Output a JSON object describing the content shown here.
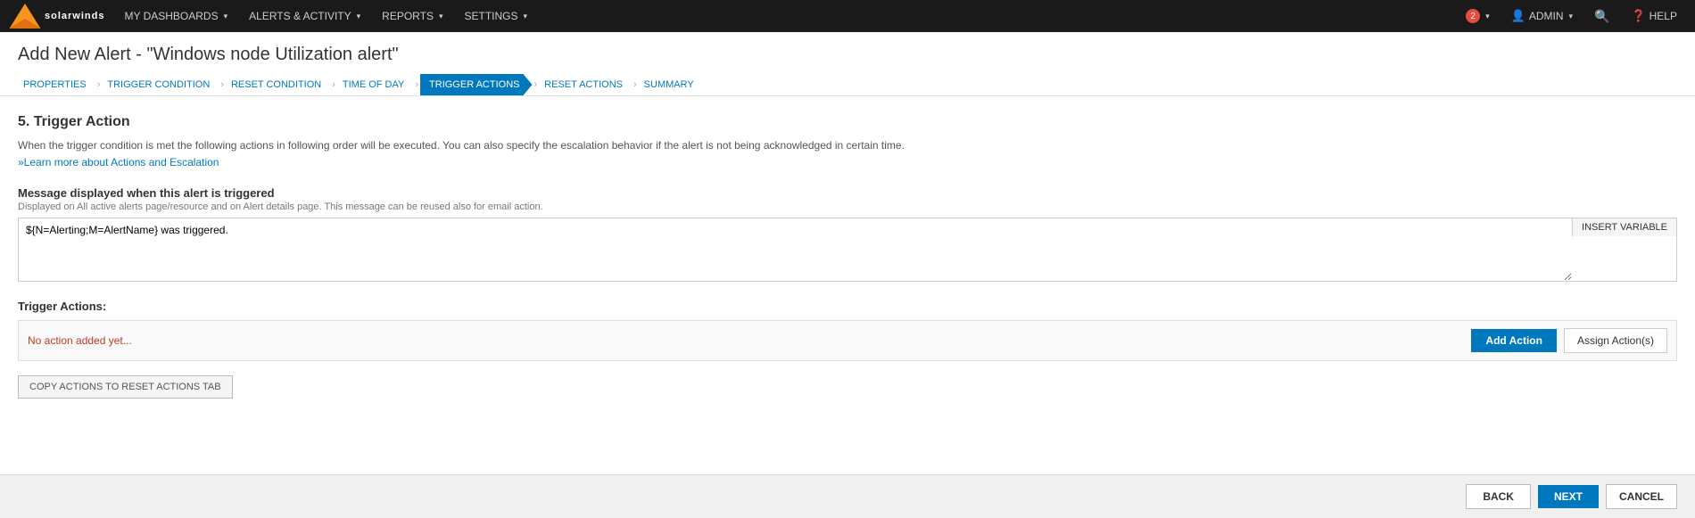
{
  "topnav": {
    "logo_alt": "SolarWinds",
    "menus": [
      {
        "label": "MY DASHBOARDS",
        "has_caret": true
      },
      {
        "label": "ALERTS & ACTIVITY",
        "has_caret": true
      },
      {
        "label": "REPORTS",
        "has_caret": true
      },
      {
        "label": "SETTINGS",
        "has_caret": true
      }
    ],
    "right": [
      {
        "label": "2",
        "type": "notif"
      },
      {
        "label": "ADMIN",
        "has_caret": true
      },
      {
        "label": "🔍",
        "type": "search"
      },
      {
        "label": "HELP",
        "type": "help"
      }
    ]
  },
  "page": {
    "title": "Add New Alert - \"Windows node Utilization alert\"",
    "breadcrumbs": [
      {
        "label": "PROPERTIES",
        "active": false
      },
      {
        "label": "TRIGGER CONDITION",
        "active": false
      },
      {
        "label": "RESET CONDITION",
        "active": false
      },
      {
        "label": "TIME OF DAY",
        "active": false
      },
      {
        "label": "TRIGGER ACTIONS",
        "active": true
      },
      {
        "label": "RESET ACTIONS",
        "active": false
      },
      {
        "label": "SUMMARY",
        "active": false
      }
    ]
  },
  "content": {
    "section_number": "5.",
    "section_title": "Trigger Action",
    "description": "When the trigger condition is met the following actions in following order will be executed. You can also specify the escalation behavior if the alert is not being acknowledged in certain time.",
    "learn_more_label": "»Learn more about Actions and Escalation",
    "message_label": "Message displayed when this alert is triggered",
    "message_sublabel": "Displayed on All active alerts page/resource and on Alert details page. This message can be reused also for email action.",
    "message_value": "${N=Alerting;M=AlertName} was triggered.",
    "insert_variable_label": "INSERT VARIABLE",
    "trigger_actions_label": "Trigger Actions:",
    "no_action_text": "No action added yet...",
    "add_action_label": "Add Action",
    "assign_action_label": "Assign Action(s)",
    "copy_actions_label": "COPY ACTIONS TO RESET ACTIONS TAB"
  },
  "footer": {
    "back_label": "BACK",
    "next_label": "NEXT",
    "cancel_label": "CANCEL"
  }
}
